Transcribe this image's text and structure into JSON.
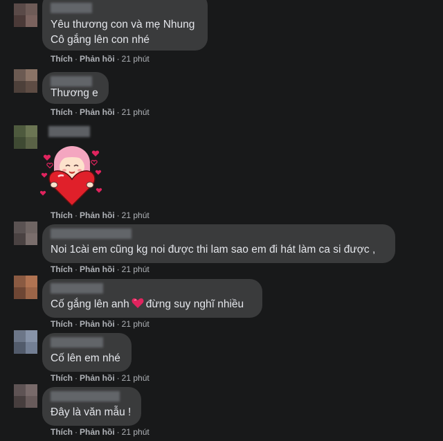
{
  "comments": [
    {
      "lines": [
        "Yêu thương con và mẹ Nhung",
        "Cô gắng lên con nhé"
      ],
      "avatar_colors": [
        "#5a4a48",
        "#6e5b57",
        "#4b3a38",
        "#7a625e"
      ]
    },
    {
      "lines": [
        "Thương e"
      ],
      "avatar_colors": [
        "#6b5a52",
        "#8a7366",
        "#4d403a",
        "#5e4c44"
      ]
    },
    {
      "lines": [],
      "avatar_colors": [
        "#4e5a3e",
        "#6b7553",
        "#3f4a33",
        "#5a6246"
      ]
    },
    {
      "lines": [
        "Noi 1cài em cũng kg noi được thi lam sao em đi hát làm ca si được ,"
      ],
      "avatar_colors": [
        "#5a5252",
        "#6f6563",
        "#4a4242",
        "#7a6e6c"
      ]
    },
    {
      "line_before_heart": "Cố gắng lên anh",
      "line_after_heart": "đừng suy nghĩ nhiều",
      "avatar_colors": [
        "#8a5a42",
        "#b07352",
        "#6e4634",
        "#9c6548"
      ]
    },
    {
      "lines": [
        "Cố lên em nhé"
      ],
      "avatar_colors": [
        "#6c7688",
        "#8793a8",
        "#525b6b",
        "#737f94"
      ]
    },
    {
      "lines": [
        "Đây là văn mẫu !"
      ],
      "avatar_colors": [
        "#5e5354",
        "#786a6a",
        "#473e3e",
        "#685b5b"
      ]
    }
  ],
  "actions": {
    "like": "Thích",
    "reply": "Phản hồi",
    "separator": "·",
    "time": "21 phút"
  },
  "colors": {
    "background": "#18191a",
    "bubble": "#3a3b3c",
    "text": "#e4e6eb",
    "meta": "#b0b3b8",
    "heart": "#e0245e",
    "sticker_hair": "#f4a6c0"
  },
  "icons": {
    "sticker": "pink-haired-girl-hugging-heart-sticker",
    "inline": "red-heart-emoji"
  }
}
